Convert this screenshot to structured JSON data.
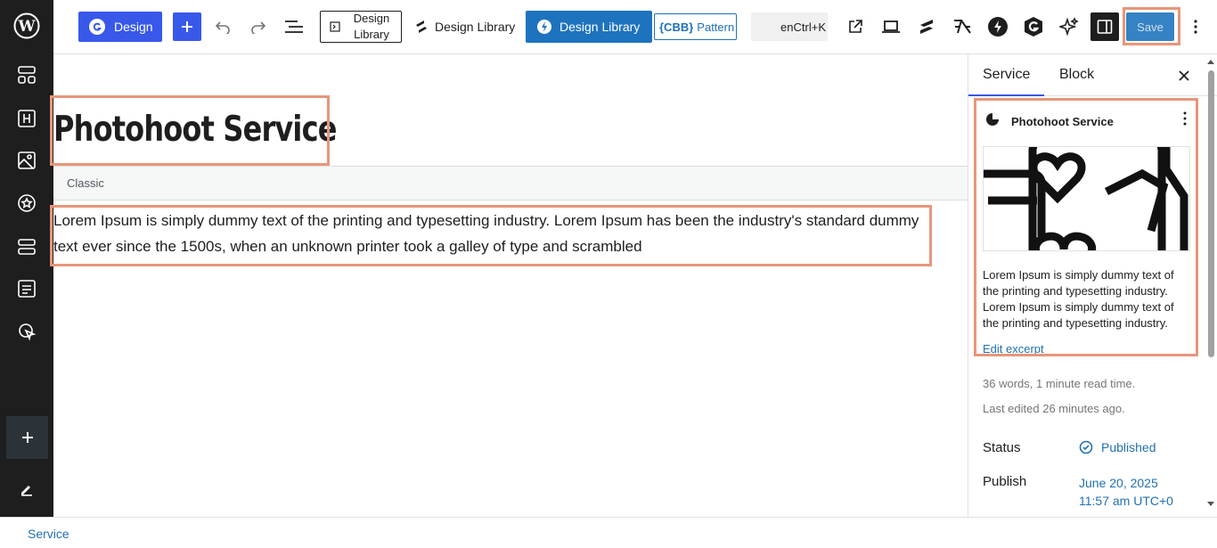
{
  "toolbar": {
    "design_label": "Design",
    "design_library_outline": "Design Library",
    "design_library_plain": "Design Library",
    "design_library_blue": "Design Library",
    "cbb_badge": "{CBB}",
    "pattern_label": "Pattern",
    "command_label": "enCtrl+K",
    "save_label": "Save",
    "accent": "#3858e9"
  },
  "editor": {
    "title": "Photohoot Service",
    "classic_label": "Classic",
    "content": "Lorem Ipsum is simply dummy text of the printing and typesetting industry. Lorem Ipsum has been the industry's standard dummy text ever since the 1500s, when an unknown printer took a galley of type and scrambled"
  },
  "sidebar": {
    "tabs": [
      "Service",
      "Block"
    ],
    "card_title": "Photohoot Service",
    "excerpt": "Lorem Ipsum is simply dummy text of the printing and typesetting industry. Lorem Ipsum is simply dummy text of the printing and typesetting industry.",
    "edit_excerpt": "Edit excerpt",
    "stats": "36 words, 1 minute read time.",
    "last_edited": "Last edited 26 minutes ago.",
    "status_label": "Status",
    "status_value": "Published",
    "publish_label": "Publish",
    "publish_date": "June 20, 2025",
    "publish_time": "11:57 am UTC+0"
  },
  "footer": {
    "breadcrumb": "Service"
  }
}
